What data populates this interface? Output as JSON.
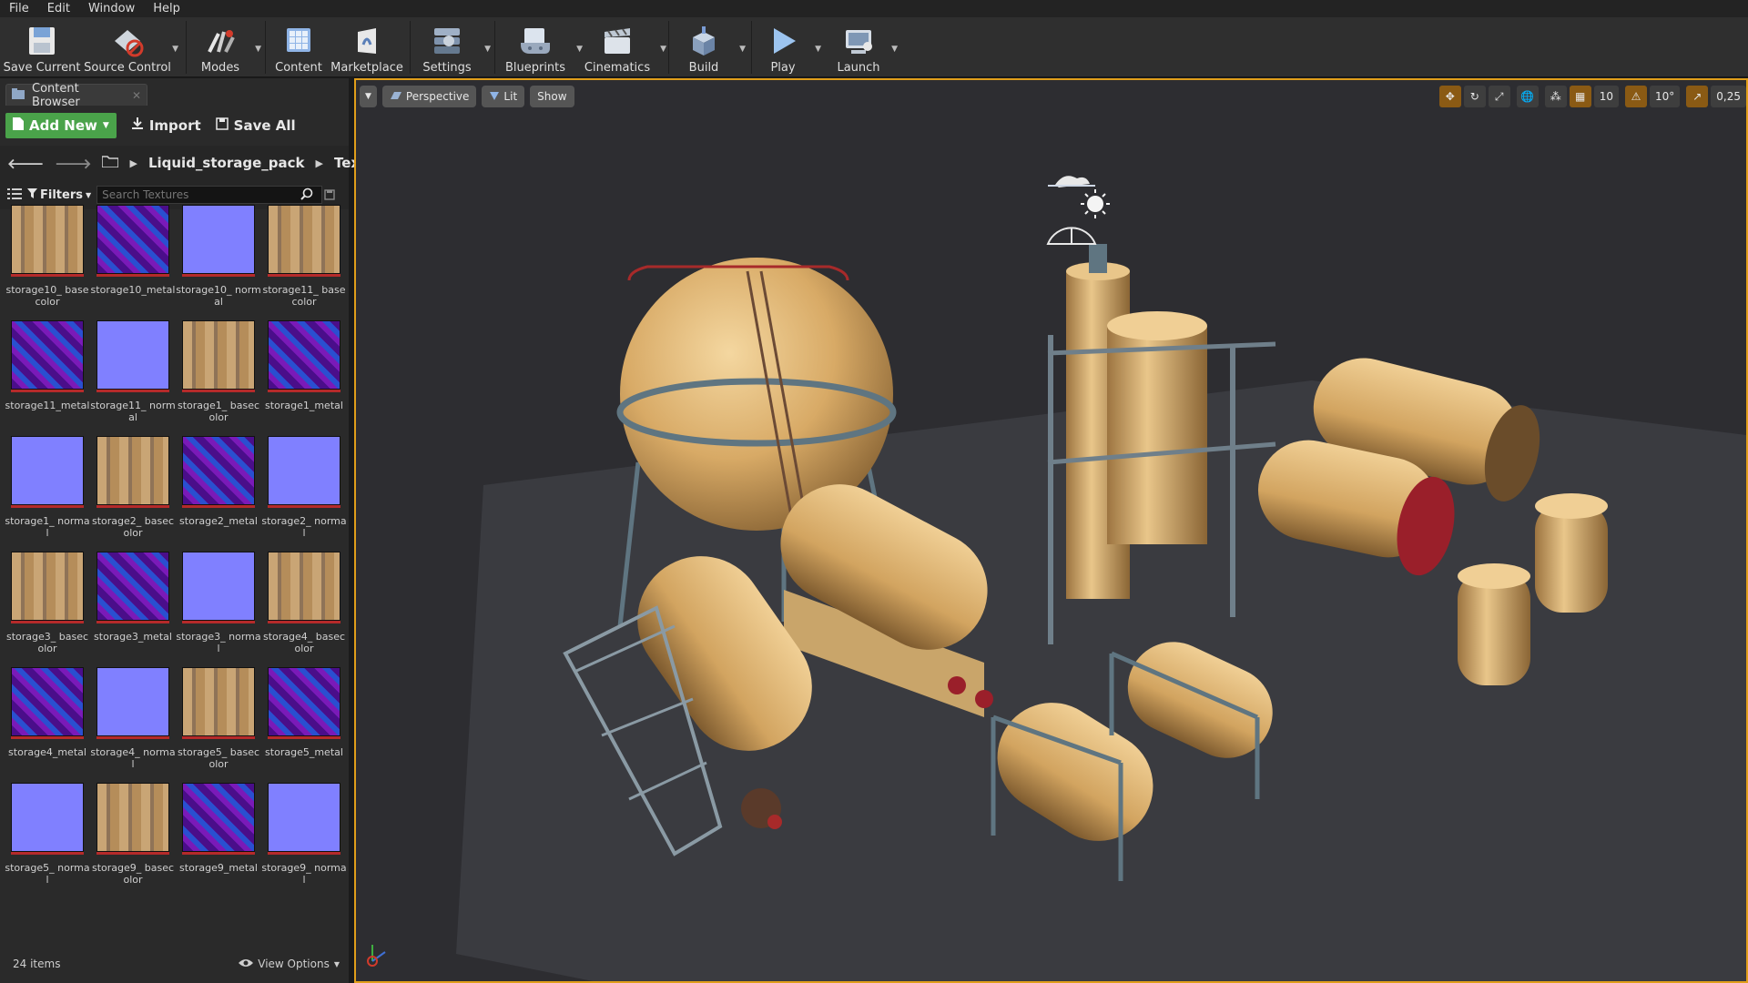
{
  "menubar": {
    "items": [
      "File",
      "Edit",
      "Window",
      "Help"
    ]
  },
  "toolbar": {
    "items": [
      {
        "label": "Save Current",
        "icon": "save-icon"
      },
      {
        "label": "Source Control",
        "icon": "source-control-icon"
      },
      {
        "label": "Modes",
        "icon": "modes-icon"
      },
      {
        "label": "Content",
        "icon": "content-icon"
      },
      {
        "label": "Marketplace",
        "icon": "marketplace-icon"
      },
      {
        "label": "Settings",
        "icon": "settings-icon"
      },
      {
        "label": "Blueprints",
        "icon": "blueprints-icon"
      },
      {
        "label": "Cinematics",
        "icon": "cinematics-icon"
      },
      {
        "label": "Build",
        "icon": "build-icon"
      },
      {
        "label": "Play",
        "icon": "play-icon"
      },
      {
        "label": "Launch",
        "icon": "launch-icon"
      }
    ]
  },
  "content_browser": {
    "tab_label": "Content Browser",
    "add_new_label": "Add New",
    "import_label": "Import",
    "save_all_label": "Save All",
    "path": [
      "Liquid_storage_pack",
      "Textures"
    ],
    "filters_label": "Filters",
    "search_placeholder": "Search Textures",
    "item_count": "24 items",
    "view_options_label": "View Options",
    "assets": [
      {
        "name": "storage10_ basecolor",
        "kind": "basecolor"
      },
      {
        "name": "storage10_metal",
        "kind": "metal"
      },
      {
        "name": "storage10_ normal",
        "kind": "normal"
      },
      {
        "name": "storage11_ basecolor",
        "kind": "basecolor"
      },
      {
        "name": "storage11_metal",
        "kind": "metal"
      },
      {
        "name": "storage11_ normal",
        "kind": "normal"
      },
      {
        "name": "storage1_ basecolor",
        "kind": "basecolor"
      },
      {
        "name": "storage1_metal",
        "kind": "metal"
      },
      {
        "name": "storage1_ normal",
        "kind": "normal"
      },
      {
        "name": "storage2_ basecolor",
        "kind": "basecolor"
      },
      {
        "name": "storage2_metal",
        "kind": "metal"
      },
      {
        "name": "storage2_ normal",
        "kind": "normal"
      },
      {
        "name": "storage3_ basecolor",
        "kind": "basecolor"
      },
      {
        "name": "storage3_metal",
        "kind": "metal"
      },
      {
        "name": "storage3_ normal",
        "kind": "normal"
      },
      {
        "name": "storage4_ basecolor",
        "kind": "basecolor"
      },
      {
        "name": "storage4_metal",
        "kind": "metal"
      },
      {
        "name": "storage4_ normal",
        "kind": "normal"
      },
      {
        "name": "storage5_ basecolor",
        "kind": "basecolor"
      },
      {
        "name": "storage5_metal",
        "kind": "metal"
      },
      {
        "name": "storage5_ normal",
        "kind": "normal"
      },
      {
        "name": "storage9_ basecolor",
        "kind": "basecolor"
      },
      {
        "name": "storage9_metal",
        "kind": "metal"
      },
      {
        "name": "storage9_ normal",
        "kind": "normal"
      }
    ]
  },
  "viewport": {
    "perspective_label": "Perspective",
    "lit_label": "Lit",
    "show_label": "Show",
    "grid_snap_value": "10",
    "rotation_snap_value": "10°",
    "scale_snap_value": "0,25",
    "accent_color": "#e09e1a"
  },
  "colors": {
    "add_new_green": "#4aa34a",
    "thumb_normal": "#8080ff",
    "thumb_metal": "#4a0e8a",
    "thumb_basecolor": "#c9a575"
  }
}
